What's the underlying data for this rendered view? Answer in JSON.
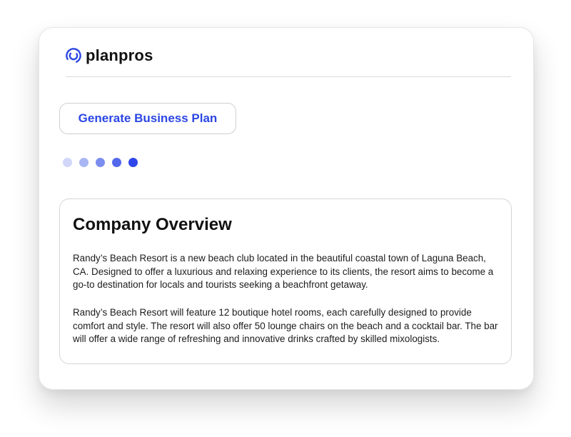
{
  "brand": {
    "name": "planpros",
    "icon": "swirl-logo-icon",
    "color": "#2b46e2"
  },
  "actions": {
    "generate_label": "Generate Business Plan"
  },
  "progress": {
    "step_count": 5,
    "dot_colors": [
      "#d0d7f9",
      "#a9b6f4",
      "#7c8df0",
      "#5468ec",
      "#2f46ea"
    ]
  },
  "overview": {
    "title": "Company Overview",
    "paragraphs": [
      "Randy’s Beach Resort is a new beach club located in the beautiful coastal town of Laguna Beach, CA. Designed to offer a luxurious and relaxing experience to its clients, the resort aims to become a go-to destination for locals and tourists seeking a beachfront getaway.",
      "Randy’s Beach Resort will feature 12 boutique hotel rooms, each carefully designed to provide comfort and style. The resort will also offer 50 lounge chairs on the beach and a cocktail bar. The bar will offer a wide range of refreshing and innovative drinks crafted by skilled mixologists."
    ]
  }
}
